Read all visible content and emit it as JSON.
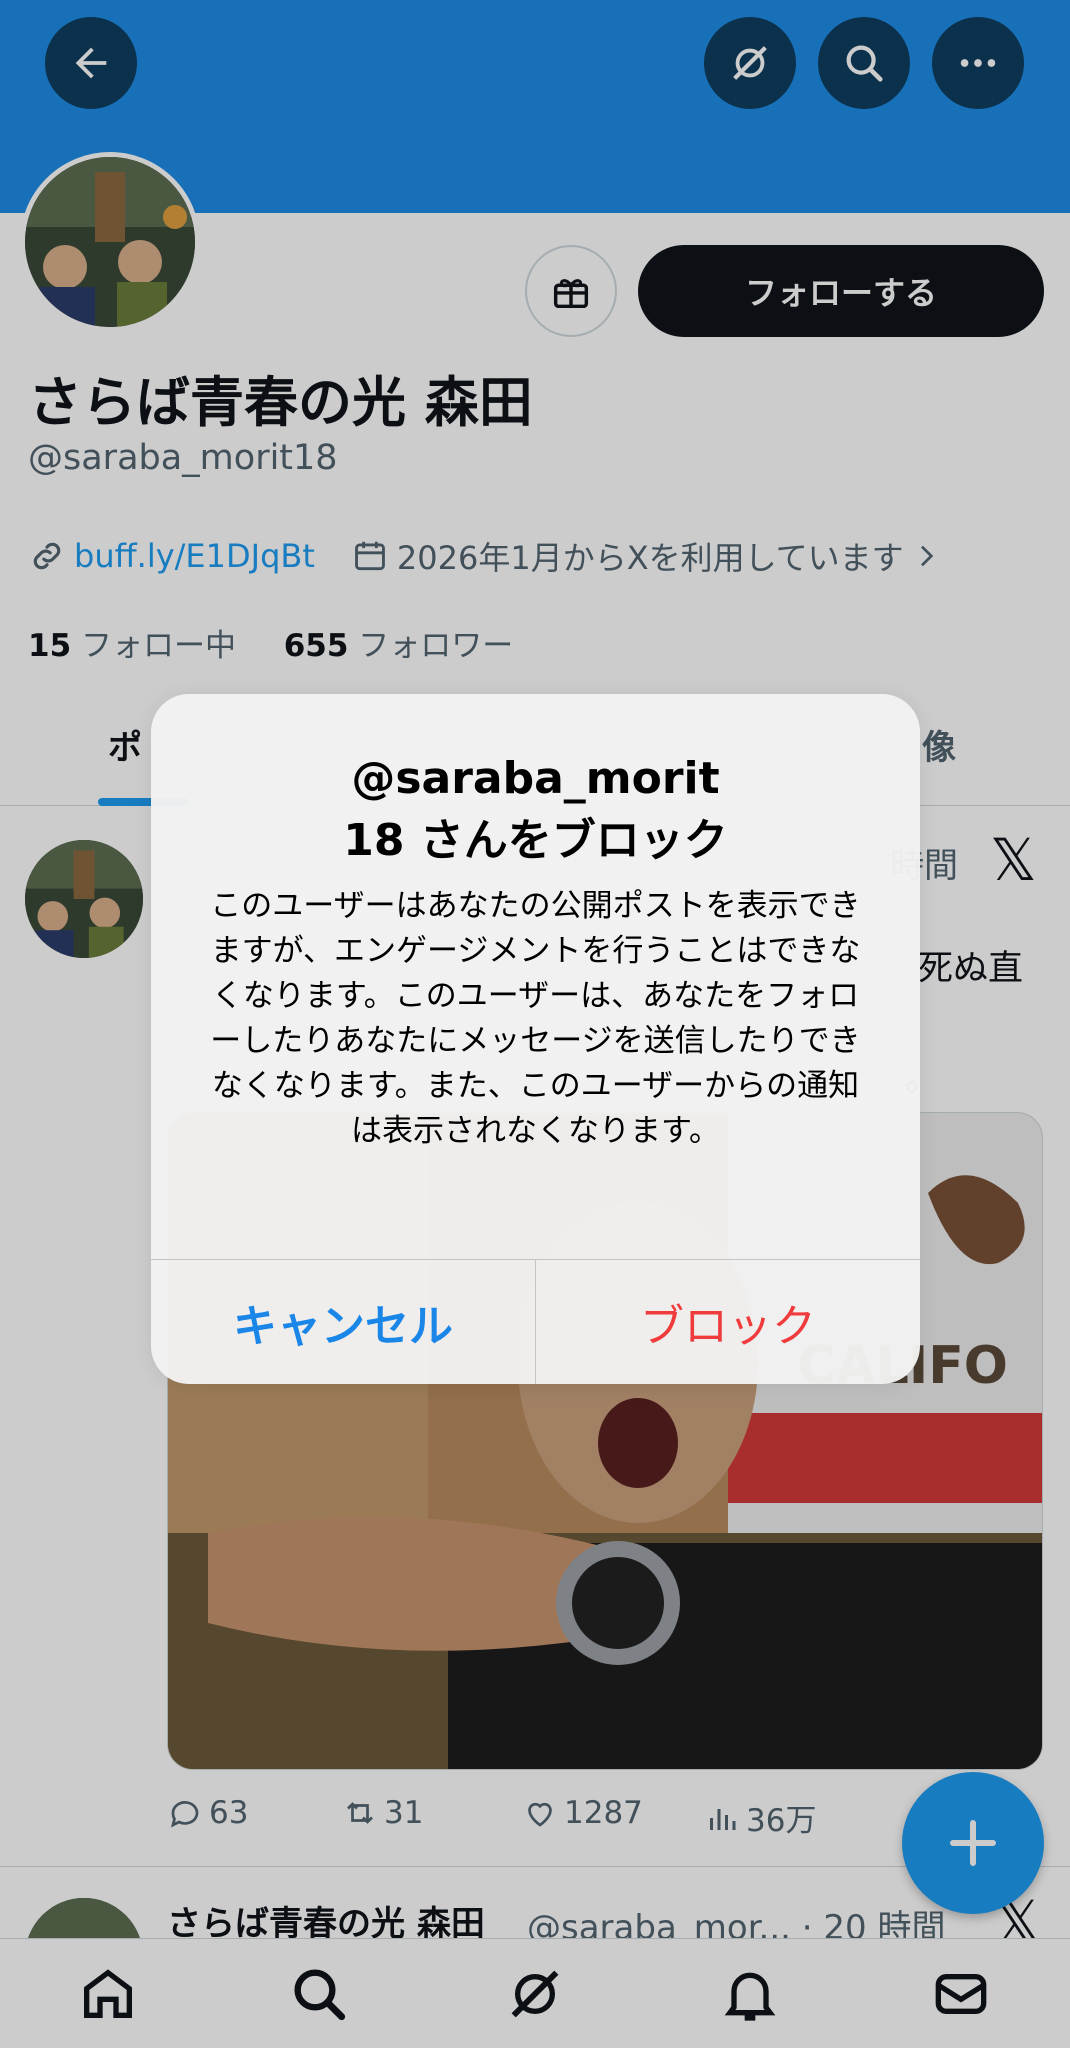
{
  "header": {
    "back_icon": "arrow-left-icon",
    "grok_icon": "grok-icon",
    "search_icon": "search-icon",
    "more_icon": "more-icon"
  },
  "profile": {
    "name": "さらば青春の光 森田",
    "handle": "@saraba_morit18",
    "follow_label": "フォローする",
    "link": "buff.ly/E1DJqBt",
    "joined": "2026年1月からXを利用しています",
    "following_count": "15",
    "following_label": "フォロー中",
    "followers_count": "655",
    "followers_label": "フォロワー"
  },
  "tabs": {
    "left_partial": "ポ",
    "right_partial": "像"
  },
  "post1": {
    "time_partial": "時間",
    "text_partial_1": "死ぬ直",
    "text_partial_2": "。",
    "replies": "63",
    "reposts": "31",
    "likes": "1287",
    "views": "36万",
    "media_flag_text": "CALIFO"
  },
  "post2": {
    "name": "さらば青春の光 森田",
    "meta": "@saraba_mor... · 20 時間"
  },
  "alert": {
    "title": "@saraba_morit 18 さんをブロック",
    "title_line1": "@saraba_morit",
    "title_line2": "18 さんをブロック",
    "message": "このユーザーはあなたの公開ポストを表示できますが、エンゲージメントを行うことはできなくなります。このユーザーは、あなたをフォローしたりあなたにメッセージを送信したりできなくなります。また、このユーザーからの通知は表示されなくなります。",
    "cancel_label": "キャンセル",
    "block_label": "ブロック"
  },
  "colors": {
    "banner": "#1d8ce6",
    "accent": "#1d9bf0",
    "cancel": "#1a86e8",
    "destructive": "#ef3b3b"
  }
}
